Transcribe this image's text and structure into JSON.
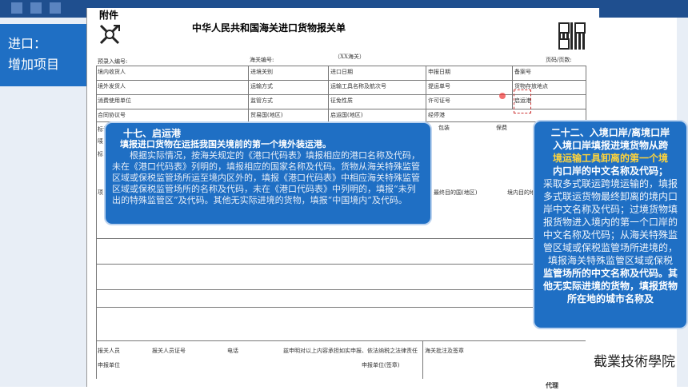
{
  "side_tag": {
    "line1": "进口：",
    "line2": "增加项目"
  },
  "form": {
    "annex": "附件",
    "title": "中华人民共和国海关进口货物报关单",
    "customs_mark": "（XX海关）",
    "pre_entry_no": "预录入编号:",
    "customs_no": "海关编号:",
    "page_no": "页码/页数:",
    "fields": {
      "consignee": "境内收货人",
      "entry_customs": "进境关别",
      "import_date": "进口日期",
      "declare_date": "申报日期",
      "record_no": "备案号",
      "overseas_shipper": "境外发货人",
      "transport_mode": "运输方式",
      "vessel": "运输工具名称及航次号",
      "bill_no": "提运单号",
      "storage": "货物存放地点",
      "consumer": "消费使用单位",
      "supervision": "监管方式",
      "tax_nature": "征免性质",
      "license_no": "许可证号",
      "depart_port": "启运港",
      "contract": "合同协议号",
      "trade_country": "贸易国(地区)",
      "origin_country": "启运国(地区)",
      "transit_port": "经停港",
      "packing": "包装",
      "fees": "保费",
      "dest_country": "原产国(地区)",
      "final_dest": "最终目的国(地区)",
      "domestic_dest": "境内目的地",
      "declarant": "报关人员",
      "declarant_id": "报关人员证号",
      "phone": "电话",
      "statement": "兹申明对以上内容承担如实申报、依法纳税之法律责任",
      "customs_note": "海关批注及签章",
      "declare_unit": "申报单位",
      "declare_seal": "申报单位(签章)"
    },
    "margin_labels": [
      "标记",
      "唛",
      "标",
      "项"
    ]
  },
  "callout_left": {
    "title": "十七、启运港",
    "subtitle": "填报进口货物在运抵我国关境前的第一个境外装运港。",
    "body": "根据实际情况，按海关规定的《港口代码表》填报相应的港口名称及代码，未在《港口代码表》列明的，填报相应的国家名称及代码。货物从海关特殊监管区域或保税监管场所运至境内区外的，填报《港口代码表》中相应海关特殊监管区域或保税监管场所的名称及代码，未在《港口代码表》中列明的，填报“未列出的特殊监管区”及代码。其他无实际进境的货物，填报“中国境内”及代码。"
  },
  "callout_right": {
    "title": "二十二、入境口岸/离境口岸",
    "intro": "入境口岸填报进境货物从跨",
    "highlight": "境运输工具卸离的第一个境",
    "line3": "内口岸的中文名称及代码；",
    "body": "采取多式联运跨境运输的，填报多式联运货物最终卸离的境内口岸中文名称及代码；过境货物填报货物进入境内的第一个口岸的中文名称及代码；从海关特殊监管区域或保税监管场所进境的，填报海关特殊监管区域或保税",
    "tail": "监管场所的中文名称及代码。其他无实际进境的货物，填报货物所在地的城市名称及"
  },
  "school_name": "截業技術學院",
  "footer_partial": "代理"
}
